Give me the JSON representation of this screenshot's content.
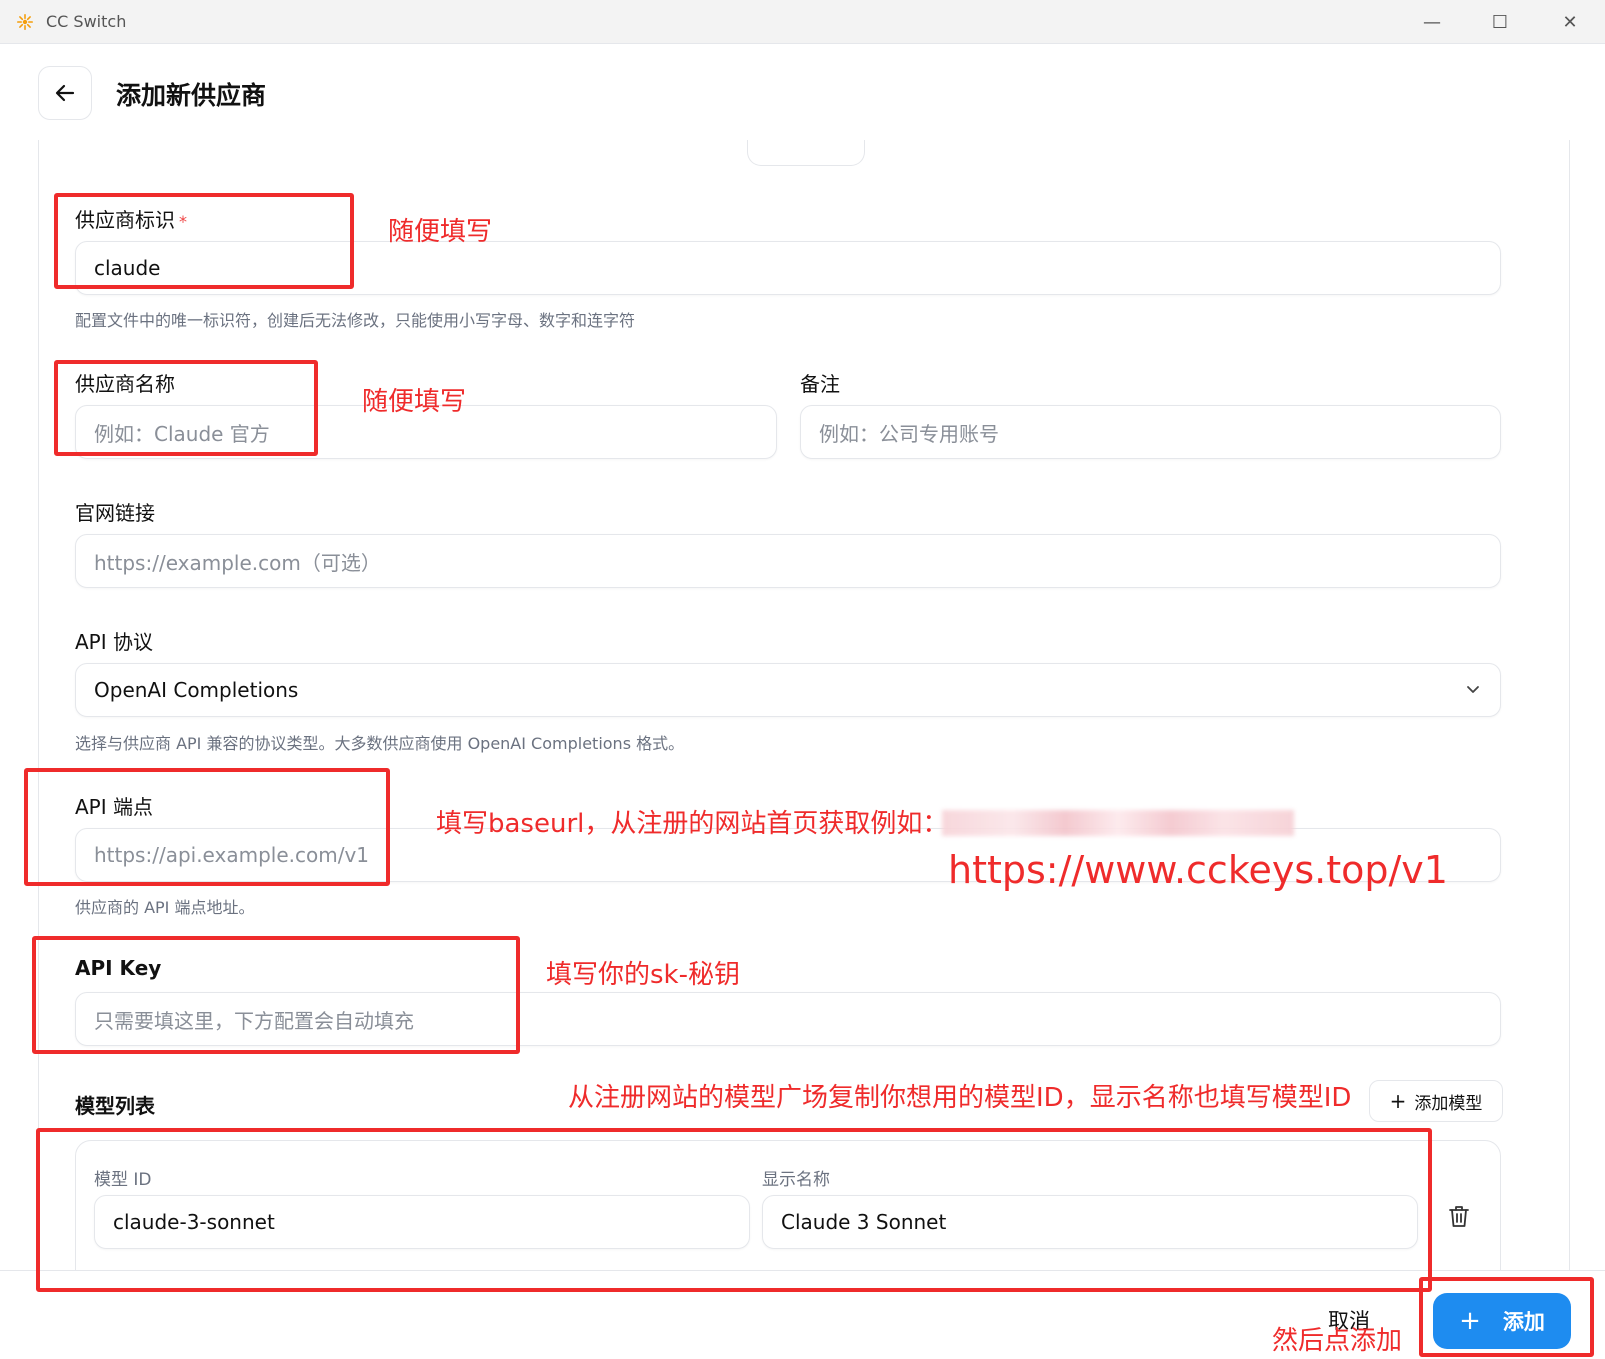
{
  "window": {
    "title": "CC Switch",
    "minimize_glyph": "—",
    "maximize_glyph": "☐",
    "close_glyph": "✕"
  },
  "header": {
    "back_icon": "arrow-left-icon",
    "title": "添加新供应商"
  },
  "form": {
    "provider_id": {
      "label": "供应商标识",
      "required_mark": "*",
      "value": "claude",
      "hint": "配置文件中的唯一标识符，创建后无法修改，只能使用小写字母、数字和连字符"
    },
    "provider_name": {
      "label": "供应商名称",
      "placeholder": "例如：Claude 官方"
    },
    "notes": {
      "label": "备注",
      "placeholder": "例如：公司专用账号"
    },
    "website": {
      "label": "官网链接",
      "placeholder": "https://example.com（可选）"
    },
    "api_protocol": {
      "label": "API 协议",
      "value": "OpenAI Completions",
      "hint": "选择与供应商 API 兼容的协议类型。大多数供应商使用 OpenAI Completions 格式。"
    },
    "api_endpoint": {
      "label": "API 端点",
      "placeholder": "https://api.example.com/v1",
      "hint": "供应商的 API 端点地址。"
    },
    "api_key": {
      "label": "API Key",
      "placeholder": "只需要填这里，下方配置会自动填充"
    },
    "models": {
      "label": "模型列表",
      "add_button": "添加模型",
      "add_icon": "plus-icon",
      "model_id_label": "模型 ID",
      "model_id_value": "claude-3-sonnet",
      "display_name_label": "显示名称",
      "display_name_value": "Claude 3 Sonnet",
      "delete_icon": "trash-icon"
    }
  },
  "footer": {
    "cancel_label": "取消",
    "submit_label": "添加",
    "submit_icon": "plus-icon"
  },
  "annotations": {
    "provider_id_note": "随便填写",
    "provider_name_note": "随便填写",
    "endpoint_note": "填写baseurl，从注册的网站首页获取例如：",
    "endpoint_url": "https://www.cckeys.top/v1",
    "api_key_note": "填写你的sk-秘钥",
    "models_note": "从注册网站的模型广场复制你想用的模型ID，显示名称也填写模型ID",
    "submit_note": "然后点添加",
    "color": "#ef2b2b"
  }
}
